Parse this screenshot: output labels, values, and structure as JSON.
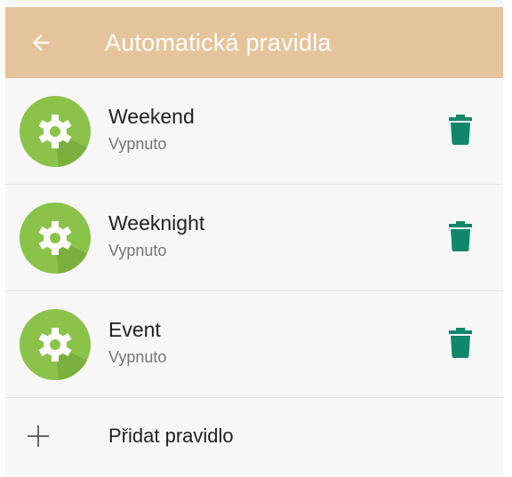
{
  "app_bar": {
    "title": "Automatická pravidla",
    "back_icon": "arrow-left-icon",
    "background_color": "#e6c49b"
  },
  "rules": [
    {
      "name": "Weekend",
      "status": "Vypnuto",
      "icon": "gear-icon",
      "action_icon": "trash-icon"
    },
    {
      "name": "Weeknight",
      "status": "Vypnuto",
      "icon": "gear-icon",
      "action_icon": "trash-icon"
    },
    {
      "name": "Event",
      "status": "Vypnuto",
      "icon": "gear-icon",
      "action_icon": "trash-icon"
    }
  ],
  "add_rule": {
    "label": "Přidat pravidlo",
    "icon": "plus-icon"
  },
  "colors": {
    "rule_icon_bg": "#8bc34a",
    "delete_icon": "#10876b"
  }
}
